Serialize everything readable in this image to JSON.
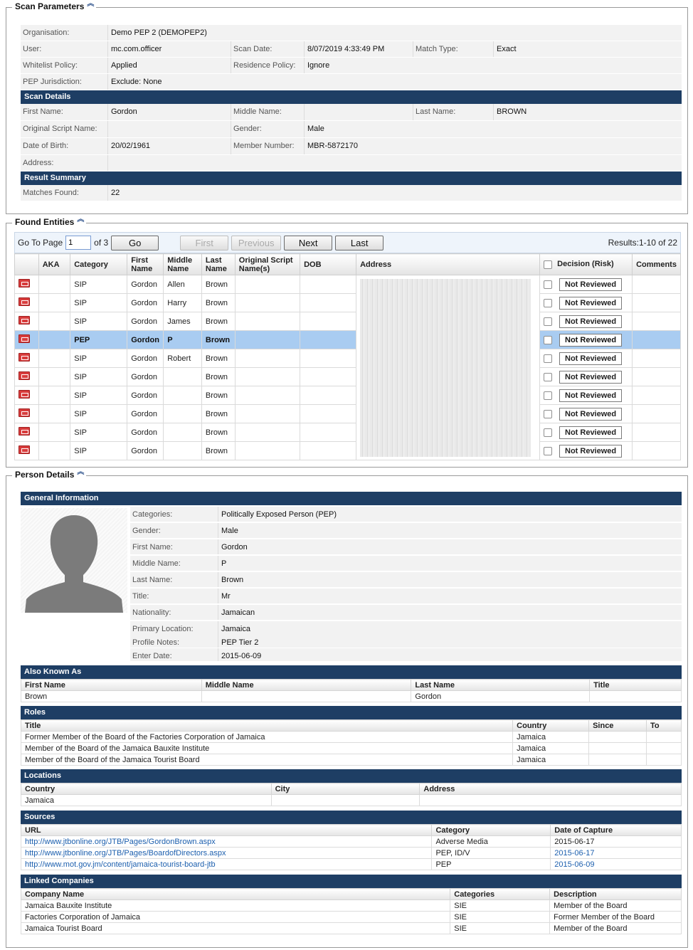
{
  "scan_parameters": {
    "title": "Scan Parameters",
    "organisation_label": "Organisation:",
    "organisation": "Demo PEP 2 (DEMOPEP2)",
    "user_label": "User:",
    "user": "mc.com.officer",
    "scan_date_label": "Scan Date:",
    "scan_date": "8/07/2019 4:33:49 PM",
    "match_type_label": "Match Type:",
    "match_type": "Exact",
    "whitelist_label": "Whitelist Policy:",
    "whitelist": "Applied",
    "residence_label": "Residence Policy:",
    "residence": "Ignore",
    "pep_juris_label": "PEP Jurisdiction:",
    "pep_juris": "Exclude: None",
    "scan_details_title": "Scan Details",
    "first_name_label": "First Name:",
    "first_name": "Gordon",
    "middle_name_label": "Middle Name:",
    "middle_name": "",
    "last_name_label": "Last Name:",
    "last_name": "BROWN",
    "osn_label": "Original Script Name:",
    "osn": "",
    "gender_label": "Gender:",
    "gender": "Male",
    "dob_label": "Date of Birth:",
    "dob": "20/02/1961",
    "member_label": "Member Number:",
    "member": "MBR-5872170",
    "address_label": "Address:",
    "address": "",
    "result_summary_title": "Result Summary",
    "matches_label": "Matches Found:",
    "matches": "22"
  },
  "found_entities": {
    "title": "Found Entities",
    "goto_label": "Go To Page",
    "page": "1",
    "of_label": "of 3",
    "go": "Go",
    "first": "First",
    "previous": "Previous",
    "next": "Next",
    "last": "Last",
    "results": "Results:1-10 of 22",
    "headers": [
      "AKA",
      "Category",
      "First Name",
      "Middle Name",
      "Last Name",
      "Original Script Name(s)",
      "DOB",
      "Address",
      "Decision (Risk)",
      "Comments"
    ],
    "decision_label": "Not Reviewed",
    "rows": [
      {
        "category": "SIP",
        "first": "Gordon",
        "middle": "Allen",
        "last": "Brown"
      },
      {
        "category": "SIP",
        "first": "Gordon",
        "middle": "Harry",
        "last": "Brown"
      },
      {
        "category": "SIP",
        "first": "Gordon",
        "middle": "James",
        "last": "Brown"
      },
      {
        "category": "PEP",
        "first": "Gordon",
        "middle": "P",
        "last": "Brown"
      },
      {
        "category": "SIP",
        "first": "Gordon",
        "middle": "Robert",
        "last": "Brown"
      },
      {
        "category": "SIP",
        "first": "Gordon",
        "middle": "",
        "last": "Brown"
      },
      {
        "category": "SIP",
        "first": "Gordon",
        "middle": "",
        "last": "Brown"
      },
      {
        "category": "SIP",
        "first": "Gordon",
        "middle": "",
        "last": "Brown"
      },
      {
        "category": "SIP",
        "first": "Gordon",
        "middle": "",
        "last": "Brown"
      },
      {
        "category": "SIP",
        "first": "Gordon",
        "middle": "",
        "last": "Brown"
      }
    ]
  },
  "person_details": {
    "title": "Person Details",
    "general_title": "General Information",
    "general": [
      {
        "label": "Categories:",
        "value": "Politically Exposed Person (PEP)"
      },
      {
        "label": "Gender:",
        "value": "Male"
      },
      {
        "label": "First Name:",
        "value": "Gordon"
      },
      {
        "label": "Middle Name:",
        "value": "P"
      },
      {
        "label": "Last Name:",
        "value": "Brown"
      },
      {
        "label": "Title:",
        "value": "Mr"
      },
      {
        "label": "Nationality:",
        "value": "Jamaican"
      },
      {
        "label": "Primary Location:",
        "value": "Jamaica"
      },
      {
        "label": "Profile Notes:",
        "value": "PEP Tier 2"
      },
      {
        "label": "Enter Date:",
        "value": "2015-06-09"
      }
    ],
    "aka_title": "Also Known As",
    "aka_headers": [
      "First Name",
      "Middle Name",
      "Last Name",
      "Title"
    ],
    "aka_row": [
      "Brown",
      "",
      "Gordon",
      ""
    ],
    "roles_title": "Roles",
    "roles_headers": [
      "Title",
      "Country",
      "Since",
      "To"
    ],
    "roles": [
      [
        "Former Member of the Board of the Factories Corporation of Jamaica",
        "Jamaica",
        "",
        ""
      ],
      [
        "Member of the Board of the Jamaica Bauxite Institute",
        "Jamaica",
        "",
        ""
      ],
      [
        "Member of the Board of the Jamaica Tourist Board",
        "Jamaica",
        "",
        ""
      ]
    ],
    "locations_title": "Locations",
    "locations_headers": [
      "Country",
      "City",
      "Address"
    ],
    "locations_row": [
      "Jamaica",
      "",
      ""
    ],
    "sources_title": "Sources",
    "sources_headers": [
      "URL",
      "Category",
      "Date of Capture"
    ],
    "sources": [
      [
        "http://www.jtbonline.org/JTB/Pages/GordonBrown.aspx",
        "Adverse Media",
        "2015-06-17"
      ],
      [
        "http://www.jtbonline.org/JTB/Pages/BoardofDirectors.aspx",
        "PEP, ID/V",
        "2015-06-17"
      ],
      [
        "http://www.mot.gov.jm/content/jamaica-tourist-board-jtb",
        "PEP",
        "2015-06-09"
      ]
    ],
    "linked_title": "Linked Companies",
    "linked_headers": [
      "Company Name",
      "Categories",
      "Description"
    ],
    "linked": [
      [
        "Jamaica Bauxite Institute",
        "SIE",
        "Member of the Board"
      ],
      [
        "Factories Corporation of Jamaica",
        "SIE",
        "Former Member of the Board"
      ],
      [
        "Jamaica Tourist Board",
        "SIE",
        "Member of the Board"
      ]
    ]
  },
  "colors": {
    "band": "#1e3e64",
    "selected_row": "#a9ccf1",
    "link": "#1c5fae"
  }
}
